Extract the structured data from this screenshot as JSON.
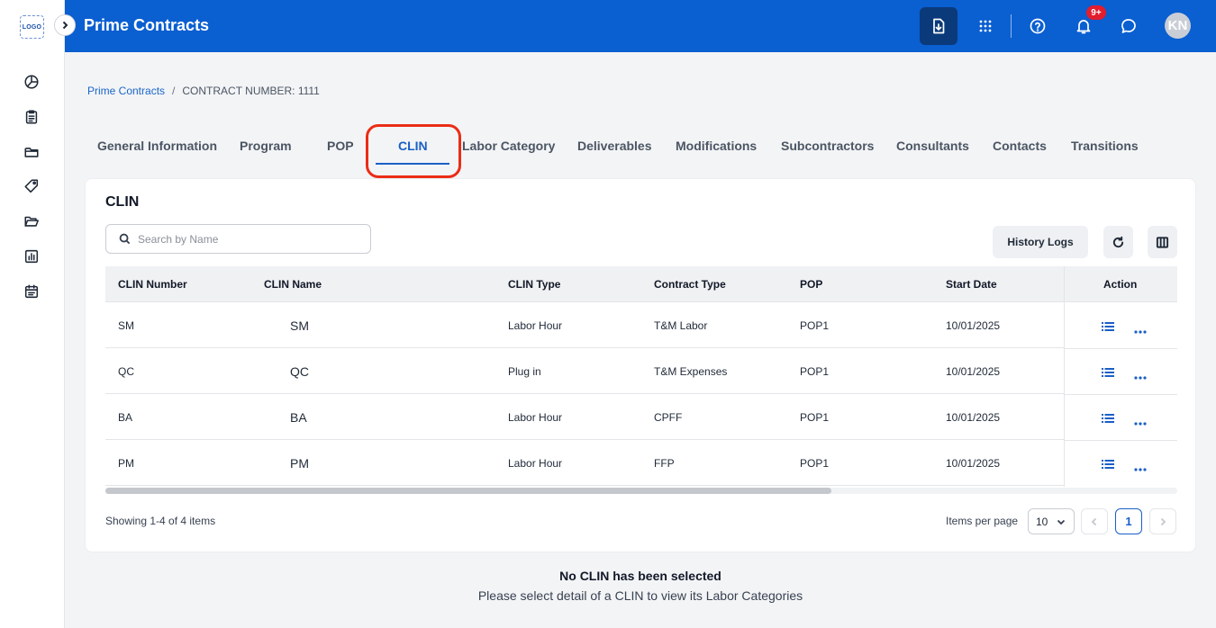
{
  "app": {
    "title": "Prime Contracts",
    "logo_text": "LOGO"
  },
  "header": {
    "notification_count": "9+",
    "avatar_initials": "KN"
  },
  "breadcrumb": {
    "root": "Prime Contracts",
    "separator": "/",
    "current": "CONTRACT NUMBER: 1111"
  },
  "tabs": [
    {
      "label": "General Information"
    },
    {
      "label": "Program"
    },
    {
      "label": "POP"
    },
    {
      "label": "CLIN",
      "active": true
    },
    {
      "label": "Labor Category"
    },
    {
      "label": "Deliverables"
    },
    {
      "label": "Modifications"
    },
    {
      "label": "Subcontractors"
    },
    {
      "label": "Consultants"
    },
    {
      "label": "Contacts"
    },
    {
      "label": "Transitions"
    }
  ],
  "clin": {
    "title": "CLIN",
    "search_placeholder": "Search by Name",
    "history_label": "History Logs",
    "columns": [
      "CLIN Number",
      "CLIN Name",
      "CLIN Type",
      "Contract Type",
      "POP",
      "Start Date",
      "Action"
    ],
    "rows": [
      {
        "number": "SM",
        "name": "SM",
        "type": "Labor Hour",
        "contract_type": "T&M Labor",
        "pop": "POP1",
        "start": "10/01/2025"
      },
      {
        "number": "QC",
        "name": "QC",
        "type": "Plug in",
        "contract_type": "T&M Expenses",
        "pop": "POP1",
        "start": "10/01/2025"
      },
      {
        "number": "BA",
        "name": "BA",
        "type": "Labor Hour",
        "contract_type": "CPFF",
        "pop": "POP1",
        "start": "10/01/2025"
      },
      {
        "number": "PM",
        "name": "PM",
        "type": "Labor Hour",
        "contract_type": "FFP",
        "pop": "POP1",
        "start": "10/01/2025"
      }
    ],
    "showing": "Showing 1-4 of 4 items",
    "items_per_page_label": "Items per page",
    "items_per_page": "10",
    "current_page": "1"
  },
  "empty_state": {
    "title": "No CLIN has been selected",
    "subtitle": "Please select detail of a CLIN to view its Labor Categories"
  },
  "colors": {
    "brand": "#0a5fd1",
    "accent": "#1a5fc6",
    "highlight": "#ea2d16",
    "badge": "#e11d2e"
  }
}
